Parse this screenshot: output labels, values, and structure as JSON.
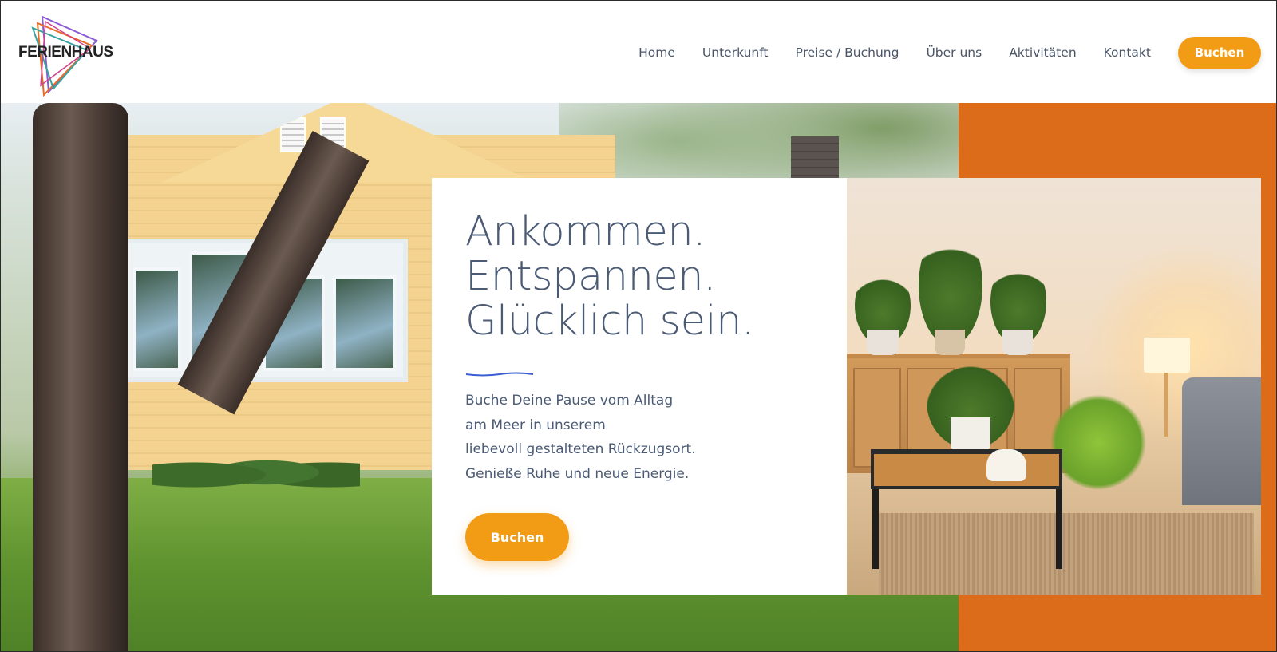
{
  "site": {
    "logo_text": "FERIENHAUS"
  },
  "nav": {
    "items": [
      {
        "label": "Home"
      },
      {
        "label": "Unterkunft"
      },
      {
        "label": "Preise / Buchung"
      },
      {
        "label": "Über uns"
      },
      {
        "label": "Aktivitäten"
      },
      {
        "label": "Kontakt"
      }
    ],
    "cta_label": "Buchen"
  },
  "hero": {
    "headline_lines": [
      "Ankommen.",
      "Entspannen.",
      "Glücklich sein."
    ],
    "body_lines": [
      "Buche Deine Pause vom Alltag",
      "am Meer in unserem",
      "liebevoll gestalteten Rückzugsort.",
      "Genieße Ruhe und neue Energie."
    ],
    "cta_label": "Buchen"
  },
  "colors": {
    "accent": "#f29c16",
    "orange_block": "#dc6c19",
    "text": "#4b5b75",
    "divider": "#3a5fd0"
  },
  "icons": {
    "logo": "triangle-logo-icon",
    "divider": "wave-divider-icon"
  }
}
